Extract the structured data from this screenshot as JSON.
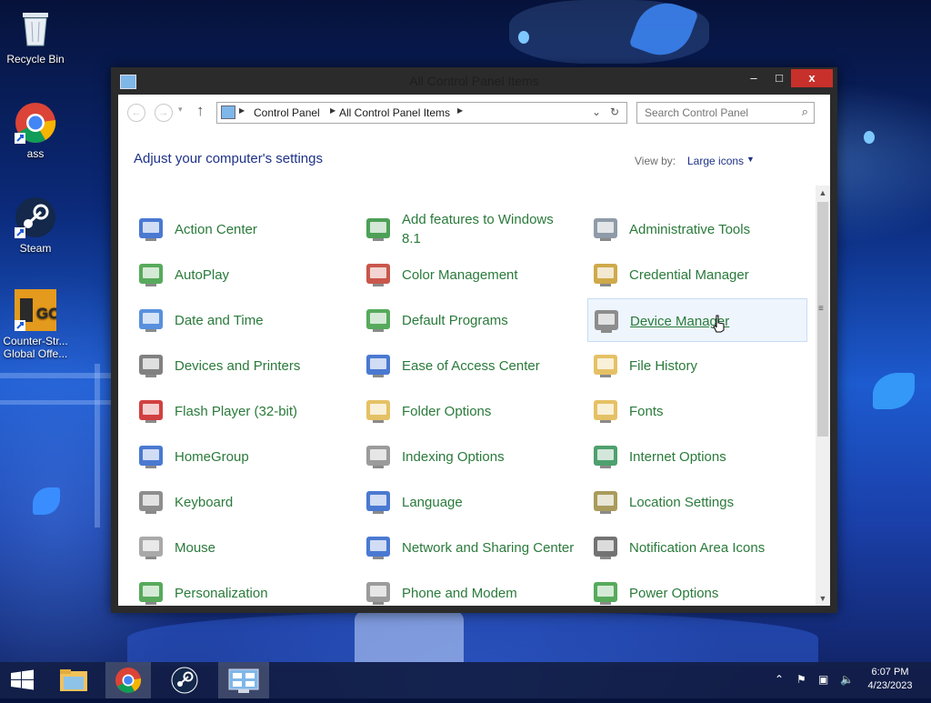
{
  "desktop": {
    "icons": [
      {
        "label": "Recycle Bin",
        "icon": "recycle-bin-icon"
      },
      {
        "label": "ass",
        "icon": "chrome-icon"
      },
      {
        "label": "Steam",
        "icon": "steam-icon"
      },
      {
        "label": "Counter-Strike: Global Offensive",
        "label_visible": "Counter-Str... Global Offe...",
        "icon": "csgo-icon"
      }
    ]
  },
  "window": {
    "title": "All Control Panel Items",
    "controls": {
      "minimize": "–",
      "maximize": "□",
      "close": "x"
    }
  },
  "navigation": {
    "breadcrumb": [
      "Control Panel",
      "All Control Panel Items"
    ],
    "search_placeholder": "Search Control Panel"
  },
  "content": {
    "heading": "Adjust your computer's settings",
    "view_by_label": "View by:",
    "view_by_value": "Large icons",
    "items": [
      {
        "label": "Action Center",
        "icon": "flag-icon",
        "color": "#2a62c9"
      },
      {
        "label": "Add features to Windows 8.1",
        "icon": "add-features-icon",
        "color": "#2e8f3a"
      },
      {
        "label": "Administrative Tools",
        "icon": "admin-tools-icon",
        "color": "#7b8a99"
      },
      {
        "label": "AutoPlay",
        "icon": "autoplay-icon",
        "color": "#3a9b3f"
      },
      {
        "label": "Color Management",
        "icon": "color-management-icon",
        "color": "#c0392b"
      },
      {
        "label": "Credential Manager",
        "icon": "credential-icon",
        "color": "#c79a2a"
      },
      {
        "label": "Date and Time",
        "icon": "clock-icon",
        "color": "#3b7dd8"
      },
      {
        "label": "Default Programs",
        "icon": "default-programs-icon",
        "color": "#3a9b3f"
      },
      {
        "label": "Device Manager",
        "icon": "device-manager-icon",
        "color": "#7a7a7a",
        "hover": true
      },
      {
        "label": "Devices and Printers",
        "icon": "printer-icon",
        "color": "#6b6b6b"
      },
      {
        "label": "Ease of Access Center",
        "icon": "ease-of-access-icon",
        "color": "#2a62c9"
      },
      {
        "label": "File History",
        "icon": "file-history-icon",
        "color": "#e0b64a"
      },
      {
        "label": "Flash Player (32-bit)",
        "icon": "flash-icon",
        "color": "#c91f1f"
      },
      {
        "label": "Folder Options",
        "icon": "folder-options-icon",
        "color": "#e0b64a"
      },
      {
        "label": "Fonts",
        "icon": "fonts-icon",
        "color": "#e0b64a"
      },
      {
        "label": "HomeGroup",
        "icon": "homegroup-icon",
        "color": "#2a62c9"
      },
      {
        "label": "Indexing Options",
        "icon": "indexing-icon",
        "color": "#8a8a8a"
      },
      {
        "label": "Internet Options",
        "icon": "internet-options-icon",
        "color": "#2f8f55"
      },
      {
        "label": "Keyboard",
        "icon": "keyboard-icon",
        "color": "#7a7a7a"
      },
      {
        "label": "Language",
        "icon": "language-icon",
        "color": "#2a62c9"
      },
      {
        "label": "Location Settings",
        "icon": "location-icon",
        "color": "#9a8a40"
      },
      {
        "label": "Mouse",
        "icon": "mouse-icon",
        "color": "#9a9a9a"
      },
      {
        "label": "Network and Sharing Center",
        "icon": "network-icon",
        "color": "#2a62c9"
      },
      {
        "label": "Notification Area Icons",
        "icon": "notification-icon",
        "color": "#5a5a5a"
      },
      {
        "label": "Personalization",
        "icon": "personalization-icon",
        "color": "#3a9b3f"
      },
      {
        "label": "Phone and Modem",
        "icon": "phone-icon",
        "color": "#8a8a8a"
      },
      {
        "label": "Power Options",
        "icon": "power-icon",
        "color": "#3a9b3f"
      }
    ]
  },
  "taskbar": {
    "apps": [
      {
        "name": "start-button"
      },
      {
        "name": "file-explorer"
      },
      {
        "name": "chrome"
      },
      {
        "name": "steam"
      },
      {
        "name": "control-panel"
      }
    ],
    "time": "6:07 PM",
    "date": "4/23/2023"
  }
}
